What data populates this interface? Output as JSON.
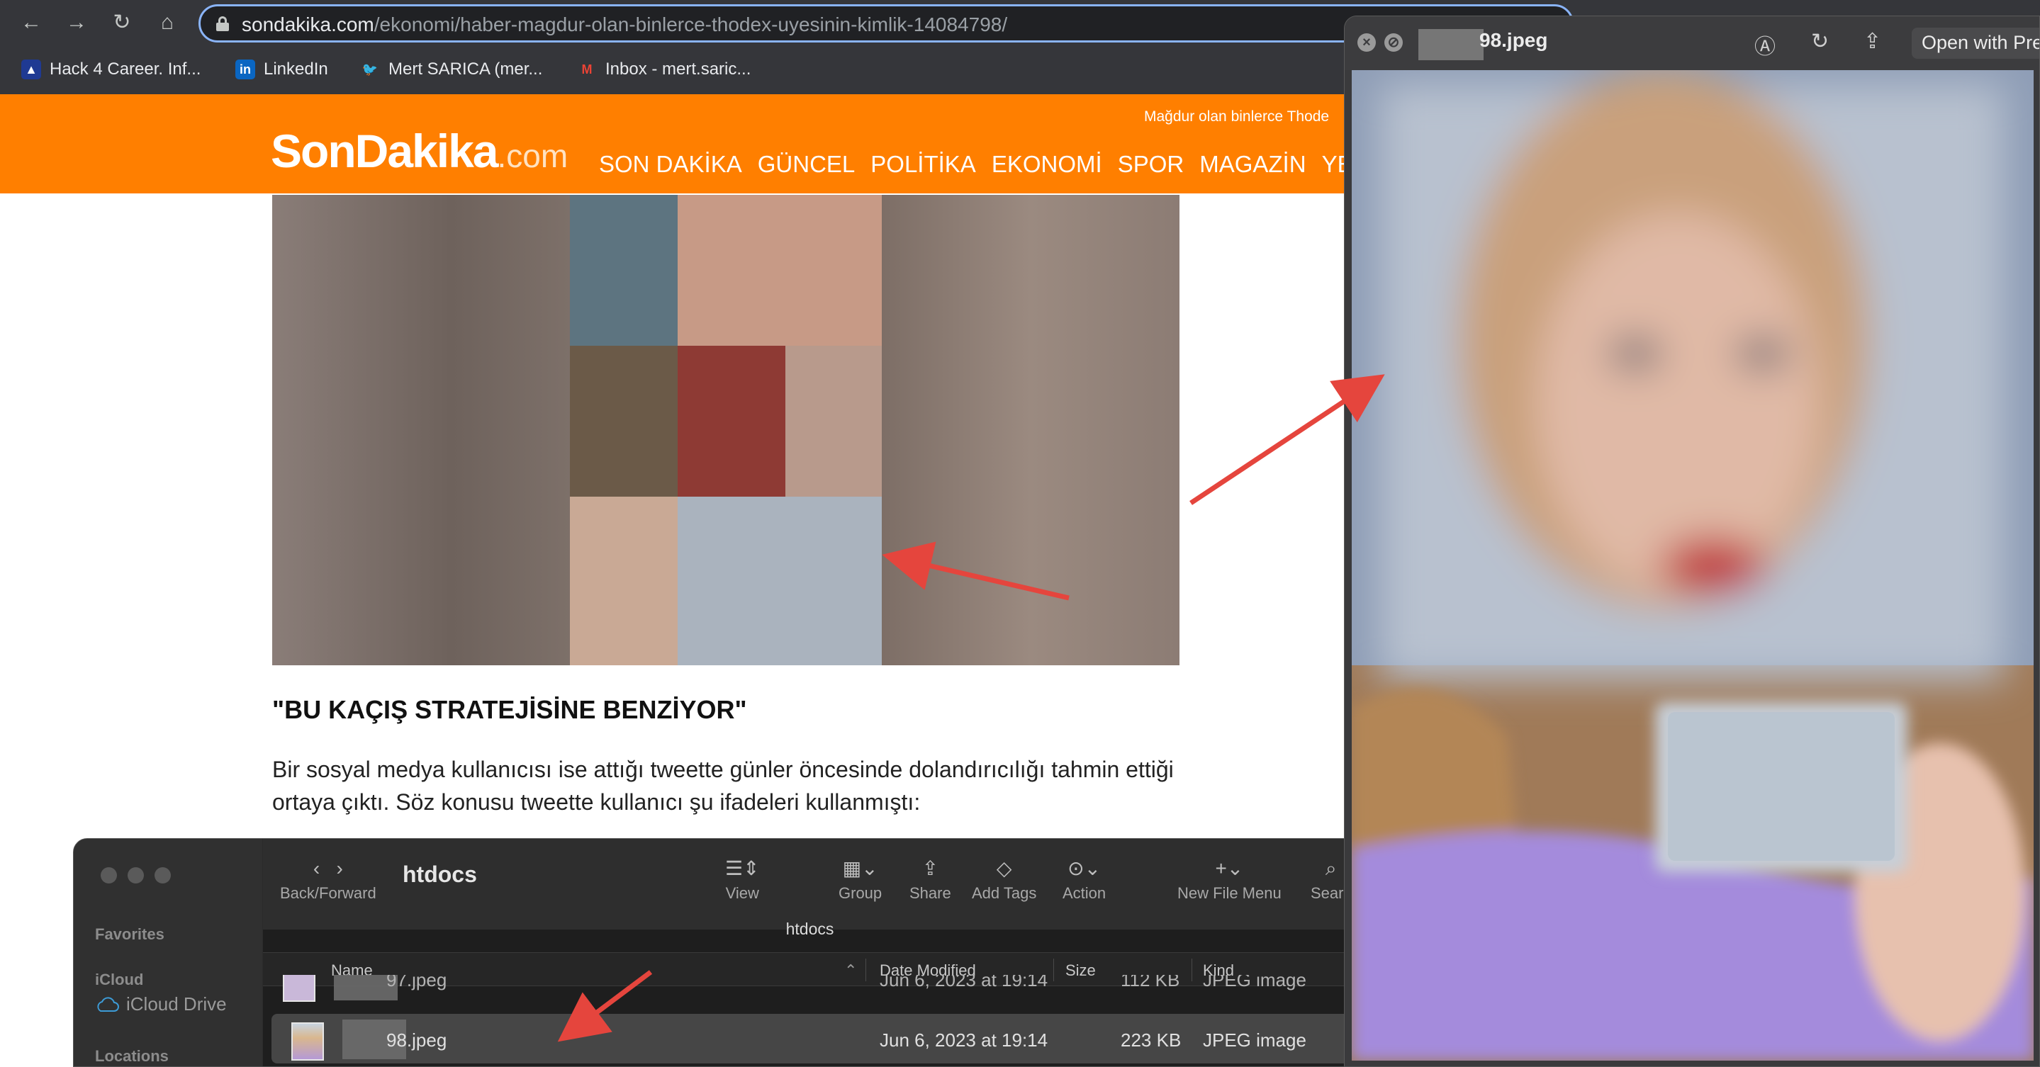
{
  "browser": {
    "nav": {
      "back_icon": "←",
      "forward_icon": "→",
      "reload_icon": "↻",
      "home_icon": "⌂"
    },
    "url_host": "sondakika.com",
    "url_path": "/ekonomi/haber-magdur-olan-binlerce-thodex-uyesinin-kimlik-14084798/",
    "bookmarks": [
      {
        "label": "Hack 4 Career. Inf...",
        "icon": "hack4career-icon",
        "glyph": "▲",
        "color": "#1f3a93"
      },
      {
        "label": "LinkedIn",
        "icon": "linkedin-icon",
        "glyph": "in",
        "color": "#0a66c2"
      },
      {
        "label": "Mert SARICA (mer...",
        "icon": "twitter-icon",
        "glyph": "🐦",
        "color": "#1d9bf0"
      },
      {
        "label": "Inbox - mert.saric...",
        "icon": "gmail-icon",
        "glyph": "M",
        "color": "#ea4335"
      }
    ]
  },
  "site": {
    "tagline": "Mağdur olan binlerce Thode",
    "logo_main": "SonDakika",
    "logo_suffix": ".com",
    "nav": [
      "SON DAKİKA",
      "GÜNCEL",
      "POLİTİKA",
      "EKONOMİ",
      "SPOR",
      "MAGAZİN",
      "YEREL"
    ],
    "accent": "#ff7f00"
  },
  "article": {
    "heading": "\"BU KAÇIŞ STRATEJİSİNE BENZİYOR\"",
    "body": "Bir sosyal medya kullanıcısı ise attığı tweette günler öncesinde dolandırıcılığı tahmin ettiği ortaya çıktı. Söz konusu tweette kullanıcı şu ifadeleri kullanmıştı:"
  },
  "finder": {
    "sidebar": {
      "favorites": "Favorites",
      "icloud": "iCloud",
      "icloud_drive": "iCloud Drive",
      "locations": "Locations"
    },
    "toolbar": {
      "back_forward_label": "Back/Forward",
      "title": "htdocs",
      "view_label": "View",
      "group_label": "Group",
      "share_label": "Share",
      "tags_label": "Add Tags",
      "action_label": "Action",
      "new_file_label": "New File Menu",
      "search_label": "Searc"
    },
    "path": "htdocs",
    "columns": {
      "name": "Name",
      "date": "Date Modified",
      "size": "Size",
      "kind": "Kind"
    },
    "files": [
      {
        "name": "97.jpeg",
        "date": "Jun 6, 2023 at 19:14",
        "size": "112 KB",
        "kind": "JPEG image"
      },
      {
        "name": "98.jpeg",
        "date": "Jun 6, 2023 at 19:14",
        "size": "223 KB",
        "kind": "JPEG image"
      }
    ]
  },
  "quicklook": {
    "filename": "98.jpeg",
    "open_with": "Open with Pre"
  }
}
